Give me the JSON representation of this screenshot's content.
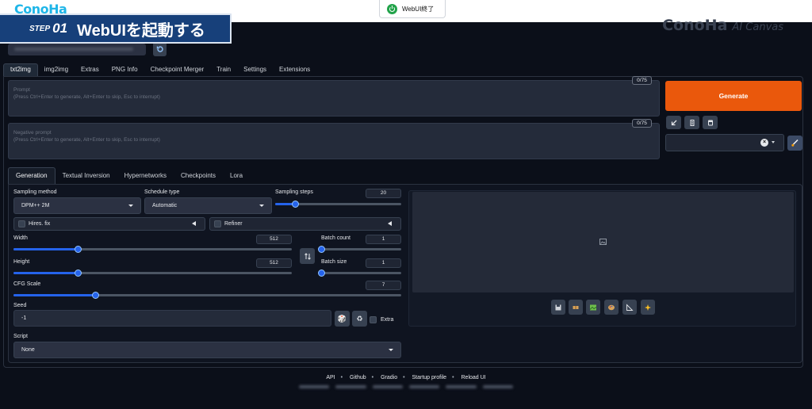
{
  "brand": {
    "logo": "ConoHa",
    "right_logo": "ConoHa",
    "right_suffix": "AI Canvas"
  },
  "shutdown_button": {
    "label": "WebUI終了"
  },
  "step": {
    "label": "STEP",
    "number": "01",
    "title": "WebUIを起動する"
  },
  "main_tabs": [
    {
      "label": "txt2img",
      "active": true
    },
    {
      "label": "img2img"
    },
    {
      "label": "Extras"
    },
    {
      "label": "PNG Info"
    },
    {
      "label": "Checkpoint Merger"
    },
    {
      "label": "Train"
    },
    {
      "label": "Settings"
    },
    {
      "label": "Extensions"
    }
  ],
  "prompt": {
    "label": "Prompt",
    "hint": "(Press Ctrl+Enter to generate, Alt+Enter to skip, Esc to interrupt)",
    "counter": "0/75"
  },
  "negative_prompt": {
    "label": "Negative prompt",
    "hint": "(Press Ctrl+Enter to generate, Alt+Enter to skip, Esc to interrupt)",
    "counter": "0/75"
  },
  "generate_label": "Generate",
  "sub_tabs": [
    {
      "label": "Generation",
      "active": true
    },
    {
      "label": "Textual Inversion"
    },
    {
      "label": "Hypernetworks"
    },
    {
      "label": "Checkpoints"
    },
    {
      "label": "Lora"
    }
  ],
  "sampling_method": {
    "label": "Sampling method",
    "value": "DPM++ 2M"
  },
  "schedule_type": {
    "label": "Schedule type",
    "value": "Automatic"
  },
  "sampling_steps": {
    "label": "Sampling steps",
    "value": "20",
    "fraction": 0.16
  },
  "hires_fix": {
    "label": "Hires. fix"
  },
  "refiner": {
    "label": "Refiner"
  },
  "width": {
    "label": "Width",
    "value": "512",
    "fraction": 0.23
  },
  "height": {
    "label": "Height",
    "value": "512",
    "fraction": 0.23
  },
  "batch_count": {
    "label": "Batch count",
    "value": "1",
    "fraction": 0.0
  },
  "batch_size": {
    "label": "Batch size",
    "value": "1",
    "fraction": 0.0
  },
  "cfg_scale": {
    "label": "CFG Scale",
    "value": "7",
    "fraction": 0.21
  },
  "seed": {
    "label": "Seed",
    "value": "-1",
    "extra_label": "Extra"
  },
  "script": {
    "label": "Script",
    "value": "None"
  },
  "footer_links": [
    "API",
    "Github",
    "Gradio",
    "Startup profile",
    "Reload UI"
  ],
  "colors": {
    "accent": "#ea580c",
    "slider": "#2563eb",
    "banner": "#17407a",
    "background": "#0b0f19"
  },
  "icons": [
    "power-icon",
    "refresh-icon",
    "arrow-icon",
    "trash-icon",
    "clipboard-icon",
    "paintbrush-icon",
    "swap-icon",
    "dice-icon",
    "recycle-icon",
    "image-icon",
    "save-icon",
    "zip-icon",
    "image-to-image-icon",
    "palette-icon",
    "ruler-icon",
    "sparkle-icon"
  ]
}
